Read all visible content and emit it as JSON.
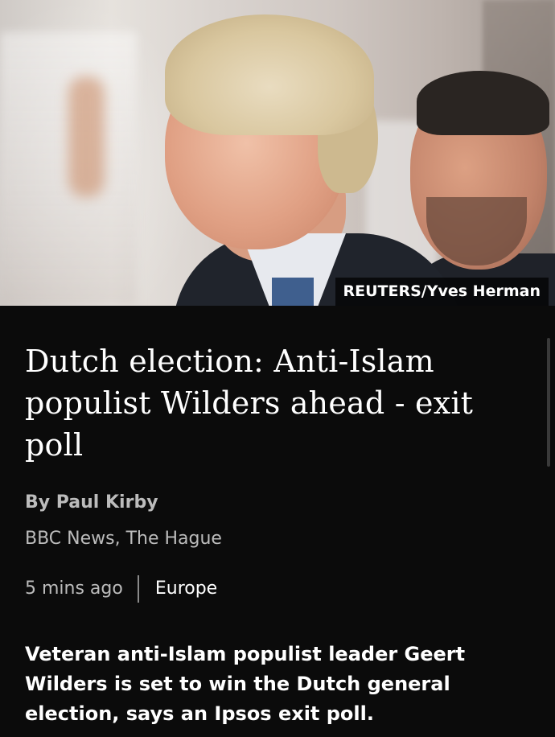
{
  "hero": {
    "photo_credit": "REUTERS/Yves Herman"
  },
  "article": {
    "headline": "Dutch election: Anti-Islam populist Wilders ahead - exit poll",
    "byline": "By Paul Kirby",
    "location": "BBC News, The Hague",
    "timestamp": "5 mins ago",
    "section": "Europe",
    "summary": "Veteran anti-Islam populist leader Geert Wilders is set to win the Dutch general election, says an Ipsos exit poll."
  },
  "colors": {
    "background": "#0b0b0b",
    "text_primary": "#ffffff",
    "text_secondary": "#bcbcbc"
  }
}
